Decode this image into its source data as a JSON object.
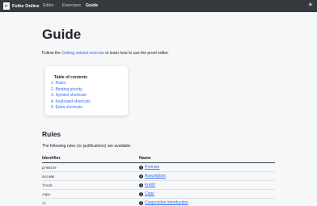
{
  "navbar": {
    "logo_glyph": "⊢",
    "brand": "Folke Online",
    "links": [
      "Editor",
      "Exercises",
      "Guide"
    ],
    "active": "Guide",
    "theme_icon": "sun-icon"
  },
  "page": {
    "title": "Guide",
    "intro_prefix": "Follow the ",
    "intro_link": "Getting started exercise",
    "intro_suffix": " to learn how to use the proof editor."
  },
  "toc": {
    "heading": "Table of contents",
    "items": [
      "1. Rules",
      "2. Binding priority",
      "3. Symbol shortcuts",
      "4. Keyboard shortcuts",
      "5. Extra shortcuts"
    ]
  },
  "rules": {
    "title": "Rules",
    "intro": "The following rules (or justifications) are available:",
    "columns": [
      "Identifier",
      "Name"
    ],
    "rows": [
      {
        "id": "premise",
        "name": "Premise"
      },
      {
        "id": "assume",
        "name": "Assumption"
      },
      {
        "id": "fresh",
        "name": "Fresh"
      },
      {
        "id": "copy",
        "name": "Copy"
      },
      {
        "id": "ci",
        "name": "Conjunction introduction"
      }
    ]
  },
  "colors": {
    "navbar_bg": "#343a40",
    "link": "#2f6df0",
    "page_bg": "#f6f7f9"
  }
}
